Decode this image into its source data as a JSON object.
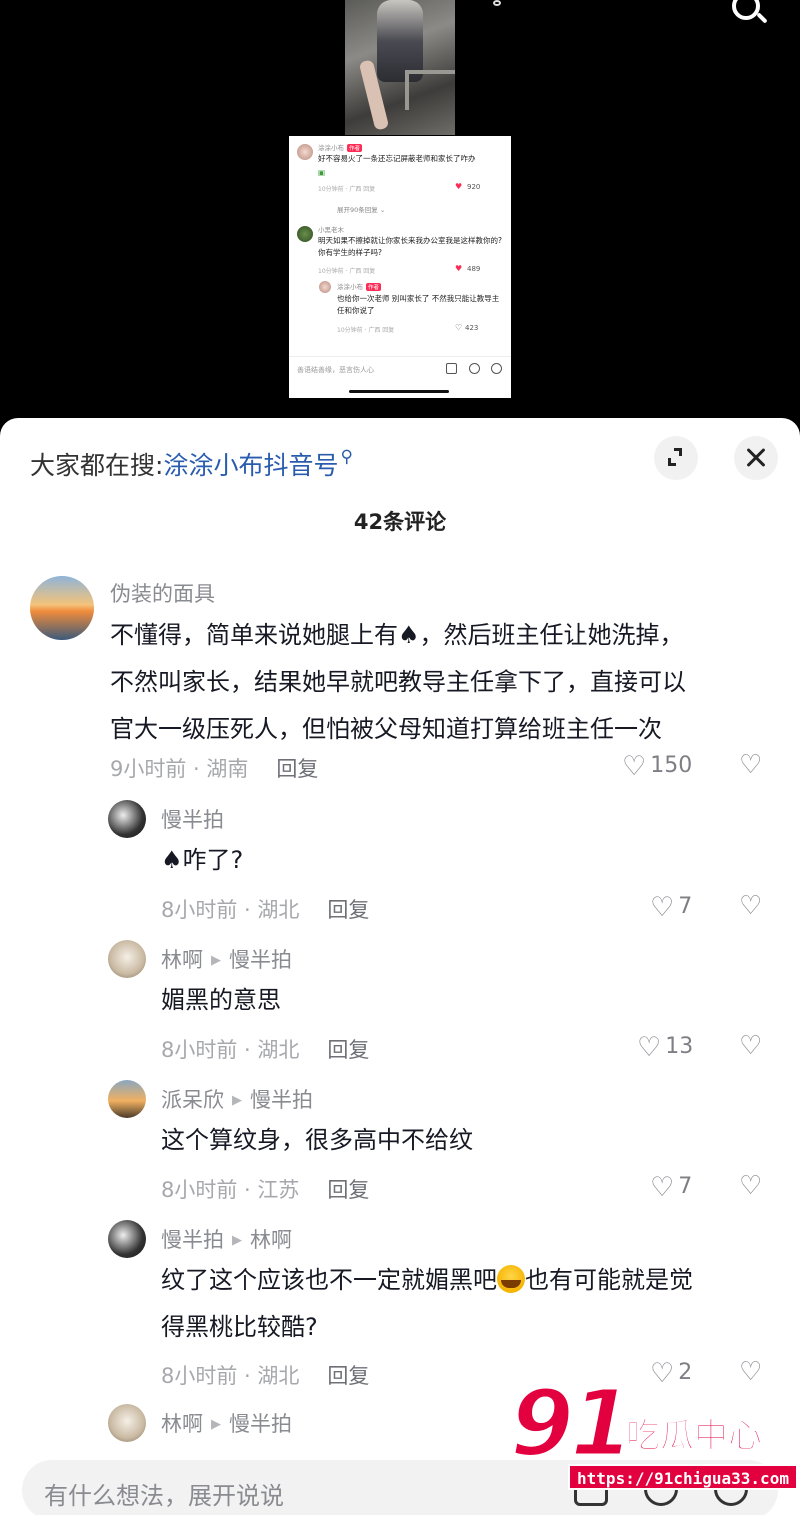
{
  "mini_screenshot": {
    "c1": {
      "name": "涂涂小布",
      "tag": "作者",
      "text": "好不容易火了一条还忘记屏蔽老师和家长了咋办",
      "meta": "10分钟前 · 广西   回复",
      "likes": "920"
    },
    "more": "展开90条回复 ⌄",
    "c2": {
      "name": "小黑老木",
      "text": "明天如果不擦掉就让你家长来我办公室我是这样教你的? 你有学生的样子吗?",
      "meta": "10分钟前 · 广西   回复",
      "likes": "489"
    },
    "c3": {
      "name": "涂涂小布",
      "tag": "作者",
      "text": "也给你一次老师 别叫家长了 不然我只能让教导主任和你说了",
      "meta": "10分钟前 · 广西   回复",
      "likes": "423"
    },
    "input_placeholder": "善语结善缘，恶言伤人心"
  },
  "sheet": {
    "search_prefix": "大家都在搜:",
    "search_keyword": "涂涂小布抖音号",
    "count_title": "42条评论"
  },
  "comments": [
    {
      "user": "伪装的面具",
      "lines": [
        "不懂得，简单来说她腿上有♠，然后班主任让她洗掉，",
        "不然叫家长，结果她早就吧教导主任拿下了，直接可以",
        "官大一级压死人，但怕被父母知道打算给班主任一次"
      ],
      "meta": "9小时前 · 湖南",
      "reply": "回复",
      "likes": "150"
    },
    {
      "user": "慢半拍",
      "reply_to": "",
      "text": "♠咋了?",
      "meta": "8小时前 · 湖北",
      "reply": "回复",
      "likes": "7"
    },
    {
      "user": "林啊",
      "reply_to": "慢半拍",
      "text": "媚黑的意思",
      "meta": "8小时前 · 湖北",
      "reply": "回复",
      "likes": "13"
    },
    {
      "user": "派呆欣",
      "reply_to": "慢半拍",
      "text": "这个算纹身，很多高中不给纹",
      "meta": "8小时前 · 江苏",
      "reply": "回复",
      "likes": "7"
    },
    {
      "user": "慢半拍",
      "reply_to": "林啊",
      "text_a": "纹了这个应该也不一定就媚黑吧",
      "text_b": "也有可能就是觉",
      "text_c": "得黑桃比较酷?",
      "meta": "8小时前 · 湖北",
      "reply": "回复",
      "likes": "2"
    },
    {
      "user": "林啊",
      "reply_to": "慢半拍"
    }
  ],
  "input": {
    "placeholder": "有什么想法，展开说说"
  },
  "watermark": {
    "logo": "91",
    "name": "吃瓜中心",
    "url": "https://91chigua33.com"
  },
  "colors": {
    "accent_link": "#2a5cad",
    "like_red": "#fe2c55",
    "watermark_red": "#e3003f"
  }
}
